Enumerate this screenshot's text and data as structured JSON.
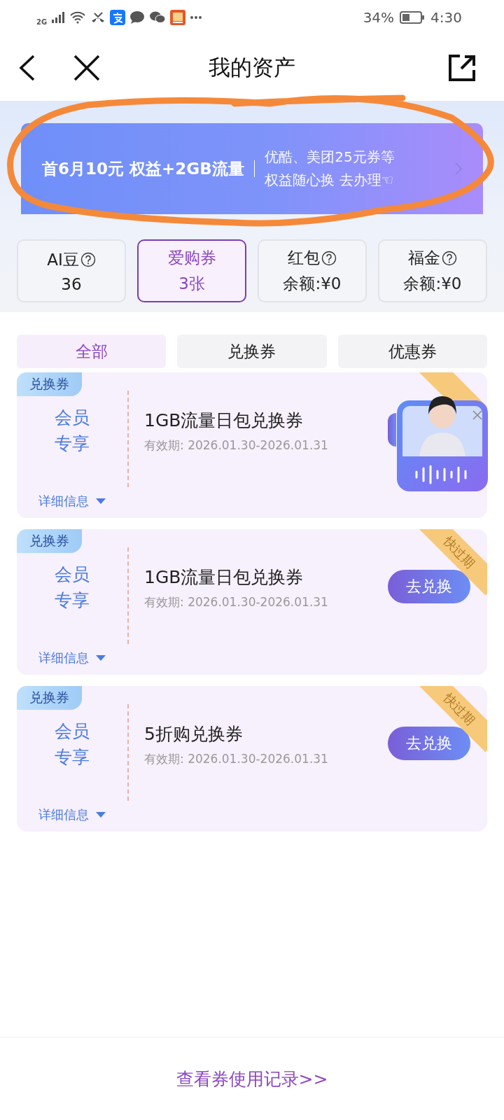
{
  "status_bar": {
    "network": "2G",
    "battery": "34%",
    "time": "4:30"
  },
  "nav": {
    "title": "我的资产"
  },
  "banner": {
    "headline": "首6月10元 权益+2GB流量",
    "line_1": "优酷、美团25元券等",
    "line_2": "权益随心换 去办理☜"
  },
  "assets": [
    {
      "label": "AI豆",
      "help": true,
      "value": "36",
      "selected": false
    },
    {
      "label": "爱购券",
      "help": false,
      "value": "3张",
      "selected": true
    },
    {
      "label": "红包",
      "help": true,
      "value": "余额:¥0",
      "selected": false
    },
    {
      "label": "福金",
      "help": true,
      "value": "余额:¥0",
      "selected": false
    }
  ],
  "tabs": [
    {
      "label": "全部",
      "selected": true
    },
    {
      "label": "兑换券",
      "selected": false
    },
    {
      "label": "优惠券",
      "selected": false
    }
  ],
  "coupons": [
    {
      "tag": "兑换券",
      "side": [
        "会员",
        "专享"
      ],
      "title": "1GB流量日包兑换券",
      "validity": "有效期: 2026.01.30-2026.01.31",
      "details": "详细信息",
      "expiring": true
    },
    {
      "tag": "兑换券",
      "side": [
        "会员",
        "专享"
      ],
      "title": "1GB流量日包兑换券",
      "validity": "有效期: 2026.01.30-2026.01.31",
      "details": "详细信息",
      "expiring": true,
      "ribbon": "快过期",
      "button": "去兑换"
    },
    {
      "tag": "兑换券",
      "side": [
        "会员",
        "专享"
      ],
      "title": "5折购兑换券",
      "validity": "有效期: 2026.01.30-2026.01.31",
      "details": "详细信息",
      "expiring": true,
      "ribbon": "快过期",
      "button": "去兑换"
    }
  ],
  "assistant": {
    "visible": true
  },
  "footer": {
    "link": "查看券使用记录>>"
  }
}
